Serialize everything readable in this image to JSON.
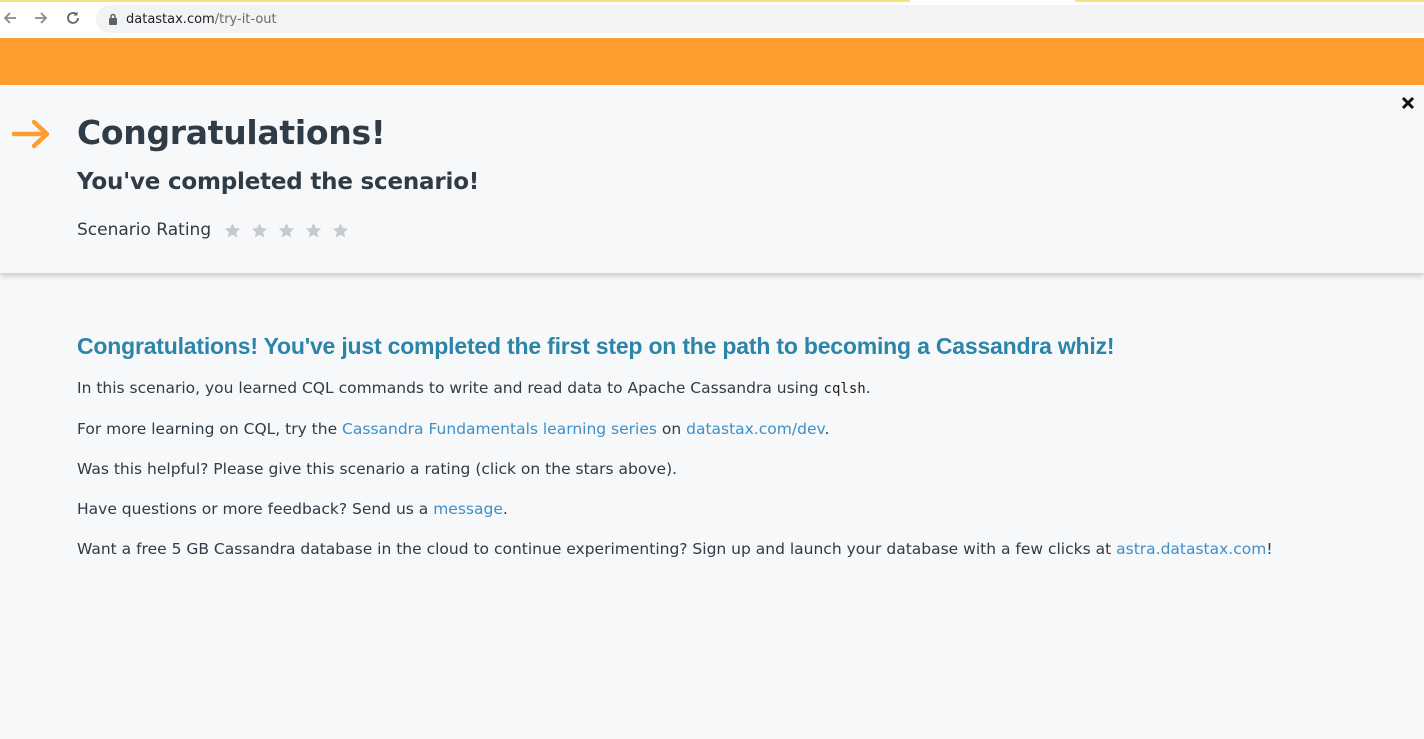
{
  "browser": {
    "url_host": "datastax.com",
    "url_path": "/try-it-out"
  },
  "modal": {
    "title": "Congratulations!",
    "subtitle": "You've completed the scenario!",
    "rating_label": "Scenario Rating",
    "rating_value": 0,
    "rating_max": 5
  },
  "content": {
    "heading": "Congratulations! You've just completed the first step on the path to becoming a Cassandra whiz!",
    "p1": {
      "text_before": "In this scenario, you learned CQL commands to write and read data to Apache Cassandra using ",
      "code": "cqlsh",
      "text_after": "."
    },
    "p2": {
      "text_before": "For more learning on CQL, try the ",
      "link1": "Cassandra Fundamentals learning series",
      "text_mid": " on ",
      "link2": "datastax.com/dev",
      "text_after": "."
    },
    "p3": {
      "text": "Was this helpful? Please give this scenario a rating (click on the stars above)."
    },
    "p4": {
      "text_before": "Have questions or more feedback? Send us a ",
      "link": "message",
      "text_after": "."
    },
    "p5": {
      "text_before": "Want a free 5 GB Cassandra database in the cloud to continue experimenting? Sign up and launch your database with a few clicks at ",
      "link": "astra.datastax.com",
      "text_after": "!"
    }
  },
  "colors": {
    "accent_orange": "#ff9e2f",
    "heading_blue": "#2c85a9",
    "link_blue": "#3f8fc9",
    "star_inactive": "#c6cad0"
  },
  "icons": {
    "back": "arrow-left-icon",
    "forward": "arrow-right-icon",
    "reload": "reload-icon",
    "lock": "lock-icon",
    "modal_arrow": "arrow-right-icon",
    "close": "close-icon",
    "star": "star-icon"
  }
}
